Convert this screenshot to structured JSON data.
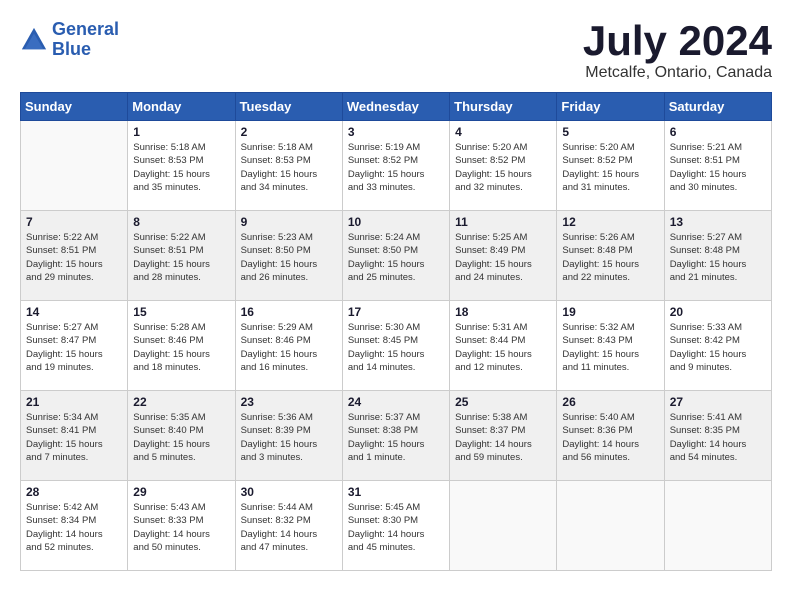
{
  "logo": {
    "line1": "General",
    "line2": "Blue"
  },
  "title": "July 2024",
  "location": "Metcalfe, Ontario, Canada",
  "days_of_week": [
    "Sunday",
    "Monday",
    "Tuesday",
    "Wednesday",
    "Thursday",
    "Friday",
    "Saturday"
  ],
  "weeks": [
    {
      "shaded": false,
      "days": [
        {
          "num": "",
          "info": ""
        },
        {
          "num": "1",
          "info": "Sunrise: 5:18 AM\nSunset: 8:53 PM\nDaylight: 15 hours\nand 35 minutes."
        },
        {
          "num": "2",
          "info": "Sunrise: 5:18 AM\nSunset: 8:53 PM\nDaylight: 15 hours\nand 34 minutes."
        },
        {
          "num": "3",
          "info": "Sunrise: 5:19 AM\nSunset: 8:52 PM\nDaylight: 15 hours\nand 33 minutes."
        },
        {
          "num": "4",
          "info": "Sunrise: 5:20 AM\nSunset: 8:52 PM\nDaylight: 15 hours\nand 32 minutes."
        },
        {
          "num": "5",
          "info": "Sunrise: 5:20 AM\nSunset: 8:52 PM\nDaylight: 15 hours\nand 31 minutes."
        },
        {
          "num": "6",
          "info": "Sunrise: 5:21 AM\nSunset: 8:51 PM\nDaylight: 15 hours\nand 30 minutes."
        }
      ]
    },
    {
      "shaded": true,
      "days": [
        {
          "num": "7",
          "info": "Sunrise: 5:22 AM\nSunset: 8:51 PM\nDaylight: 15 hours\nand 29 minutes."
        },
        {
          "num": "8",
          "info": "Sunrise: 5:22 AM\nSunset: 8:51 PM\nDaylight: 15 hours\nand 28 minutes."
        },
        {
          "num": "9",
          "info": "Sunrise: 5:23 AM\nSunset: 8:50 PM\nDaylight: 15 hours\nand 26 minutes."
        },
        {
          "num": "10",
          "info": "Sunrise: 5:24 AM\nSunset: 8:50 PM\nDaylight: 15 hours\nand 25 minutes."
        },
        {
          "num": "11",
          "info": "Sunrise: 5:25 AM\nSunset: 8:49 PM\nDaylight: 15 hours\nand 24 minutes."
        },
        {
          "num": "12",
          "info": "Sunrise: 5:26 AM\nSunset: 8:48 PM\nDaylight: 15 hours\nand 22 minutes."
        },
        {
          "num": "13",
          "info": "Sunrise: 5:27 AM\nSunset: 8:48 PM\nDaylight: 15 hours\nand 21 minutes."
        }
      ]
    },
    {
      "shaded": false,
      "days": [
        {
          "num": "14",
          "info": "Sunrise: 5:27 AM\nSunset: 8:47 PM\nDaylight: 15 hours\nand 19 minutes."
        },
        {
          "num": "15",
          "info": "Sunrise: 5:28 AM\nSunset: 8:46 PM\nDaylight: 15 hours\nand 18 minutes."
        },
        {
          "num": "16",
          "info": "Sunrise: 5:29 AM\nSunset: 8:46 PM\nDaylight: 15 hours\nand 16 minutes."
        },
        {
          "num": "17",
          "info": "Sunrise: 5:30 AM\nSunset: 8:45 PM\nDaylight: 15 hours\nand 14 minutes."
        },
        {
          "num": "18",
          "info": "Sunrise: 5:31 AM\nSunset: 8:44 PM\nDaylight: 15 hours\nand 12 minutes."
        },
        {
          "num": "19",
          "info": "Sunrise: 5:32 AM\nSunset: 8:43 PM\nDaylight: 15 hours\nand 11 minutes."
        },
        {
          "num": "20",
          "info": "Sunrise: 5:33 AM\nSunset: 8:42 PM\nDaylight: 15 hours\nand 9 minutes."
        }
      ]
    },
    {
      "shaded": true,
      "days": [
        {
          "num": "21",
          "info": "Sunrise: 5:34 AM\nSunset: 8:41 PM\nDaylight: 15 hours\nand 7 minutes."
        },
        {
          "num": "22",
          "info": "Sunrise: 5:35 AM\nSunset: 8:40 PM\nDaylight: 15 hours\nand 5 minutes."
        },
        {
          "num": "23",
          "info": "Sunrise: 5:36 AM\nSunset: 8:39 PM\nDaylight: 15 hours\nand 3 minutes."
        },
        {
          "num": "24",
          "info": "Sunrise: 5:37 AM\nSunset: 8:38 PM\nDaylight: 15 hours\nand 1 minute."
        },
        {
          "num": "25",
          "info": "Sunrise: 5:38 AM\nSunset: 8:37 PM\nDaylight: 14 hours\nand 59 minutes."
        },
        {
          "num": "26",
          "info": "Sunrise: 5:40 AM\nSunset: 8:36 PM\nDaylight: 14 hours\nand 56 minutes."
        },
        {
          "num": "27",
          "info": "Sunrise: 5:41 AM\nSunset: 8:35 PM\nDaylight: 14 hours\nand 54 minutes."
        }
      ]
    },
    {
      "shaded": false,
      "days": [
        {
          "num": "28",
          "info": "Sunrise: 5:42 AM\nSunset: 8:34 PM\nDaylight: 14 hours\nand 52 minutes."
        },
        {
          "num": "29",
          "info": "Sunrise: 5:43 AM\nSunset: 8:33 PM\nDaylight: 14 hours\nand 50 minutes."
        },
        {
          "num": "30",
          "info": "Sunrise: 5:44 AM\nSunset: 8:32 PM\nDaylight: 14 hours\nand 47 minutes."
        },
        {
          "num": "31",
          "info": "Sunrise: 5:45 AM\nSunset: 8:30 PM\nDaylight: 14 hours\nand 45 minutes."
        },
        {
          "num": "",
          "info": ""
        },
        {
          "num": "",
          "info": ""
        },
        {
          "num": "",
          "info": ""
        }
      ]
    }
  ]
}
